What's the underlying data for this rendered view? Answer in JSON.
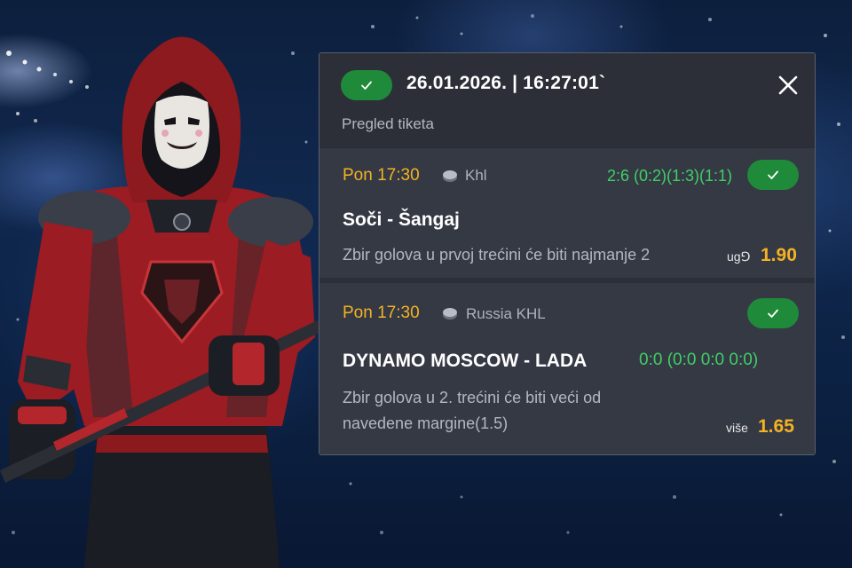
{
  "ticket": {
    "datetime": "26.01.2026. | 16:27:01`",
    "subtitle": "Pregled tiketa",
    "status_icon": "check-icon",
    "close_icon": "close-icon"
  },
  "bets": [
    {
      "time": "Pon 17:30",
      "league": "Khl",
      "result": "2:6 (0:2)(1:3)(1:1)",
      "match": "Soči - Šangaj",
      "market": "Zbir golova u prvoj trećini će biti najmanje 2",
      "pick": "ug⅁",
      "odd": "1.90"
    },
    {
      "time": "Pon 17:30",
      "league": "Russia KHL",
      "result": "0:0 (0:0 0:0 0:0)",
      "match": "DYNAMO MOSCOW - LADA",
      "market_line1": "Zbir golova u 2. trećini će biti veći od",
      "market_line2": "navedene margine(1.5)",
      "pick": "više",
      "odd": "1.65"
    }
  ],
  "colors": {
    "accent_green": "#1f8a3a",
    "score_green": "#3fd067",
    "odd_orange": "#f4b223",
    "panel_bg": "#2c2f38",
    "row_bg": "#353944"
  }
}
